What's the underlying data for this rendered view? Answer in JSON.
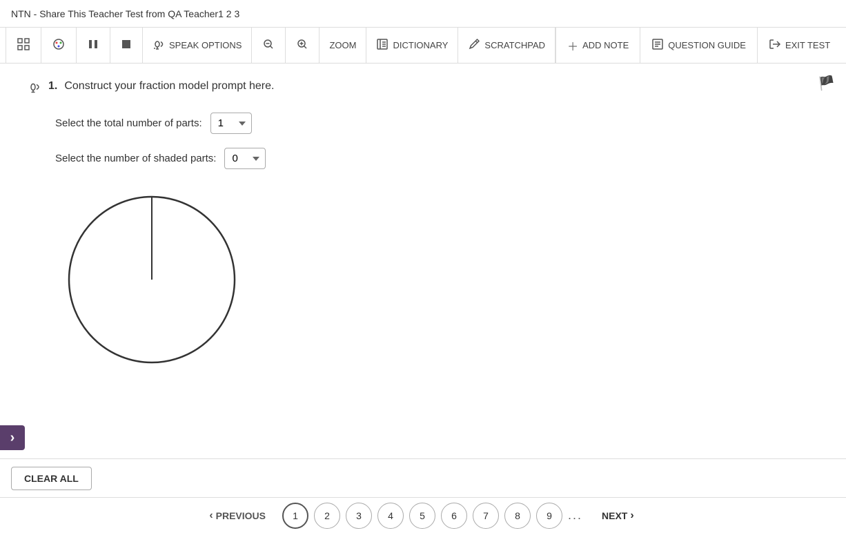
{
  "title": "NTN - Share This Teacher Test from QA Teacher1 2 3",
  "toolbar": {
    "items": [
      {
        "id": "grid",
        "icon": "⊞",
        "label": ""
      },
      {
        "id": "palette",
        "icon": "🎨",
        "label": ""
      },
      {
        "id": "pause",
        "icon": "⏸",
        "label": ""
      },
      {
        "id": "stop",
        "icon": "■",
        "label": ""
      },
      {
        "id": "speak",
        "icon": "🔊",
        "label": "SPEAK OPTIONS"
      },
      {
        "id": "zoom-out",
        "icon": "🔍-",
        "label": ""
      },
      {
        "id": "zoom-in",
        "icon": "🔍+",
        "label": ""
      },
      {
        "id": "zoom-label",
        "icon": "",
        "label": "ZOOM"
      },
      {
        "id": "dictionary",
        "icon": "📖",
        "label": "DICTIONARY"
      },
      {
        "id": "scratchpad",
        "icon": "✏",
        "label": "SCRATCHPAD"
      }
    ],
    "right": [
      {
        "id": "add-note",
        "icon": "➕",
        "label": "ADD NOTE"
      },
      {
        "id": "question-guide",
        "icon": "📋",
        "label": "QUESTION GUIDE"
      },
      {
        "id": "exit-test",
        "icon": "↩",
        "label": "EXIT TEST"
      }
    ]
  },
  "question": {
    "number": "1.",
    "text": "Construct your fraction model prompt here.",
    "total_parts_label": "Select the total number of parts:",
    "total_parts_value": "1",
    "shaded_parts_label": "Select the number of shaded parts:",
    "shaded_parts_value": "0"
  },
  "bottom": {
    "clear_all": "CLEAR ALL"
  },
  "navigation": {
    "previous": "PREVIOUS",
    "next": "NEXT",
    "pages": [
      "1",
      "2",
      "3",
      "4",
      "5",
      "6",
      "7",
      "8",
      "9"
    ],
    "dots": "...",
    "active_page": "1"
  },
  "expand_icon": "›"
}
